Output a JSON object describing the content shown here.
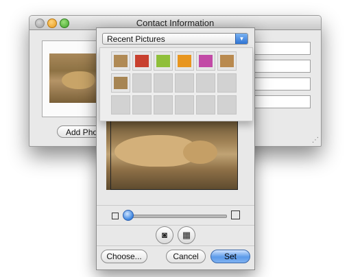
{
  "window": {
    "title": "Contact Information",
    "add_photo_label": "Add Photo..."
  },
  "picture_taker": {
    "popup_selected": "Recent Pictures",
    "recent_thumbnails": [
      {
        "name": "lion-thumbnail-icon",
        "color": "#b08a55"
      },
      {
        "name": "portrait-thumbnail-icon",
        "color": "#c8402f"
      },
      {
        "name": "apple-thumbnail-icon",
        "color": "#8fbf3a"
      },
      {
        "name": "sunflower-thumbnail-icon",
        "color": "#e8961f"
      },
      {
        "name": "flower-thumbnail-icon",
        "color": "#c24aa6"
      },
      {
        "name": "antelope-thumbnail-icon",
        "color": "#b98a4f"
      },
      {
        "name": "lion2-thumbnail-icon",
        "color": "#a78553"
      }
    ],
    "buttons": {
      "choose": "Choose...",
      "cancel": "Cancel",
      "set": "Set"
    },
    "zoom_slider": {
      "value": 0.0
    }
  },
  "colors": {
    "accent": "#3a84e0",
    "panel_bg": "#e8e8e8"
  }
}
